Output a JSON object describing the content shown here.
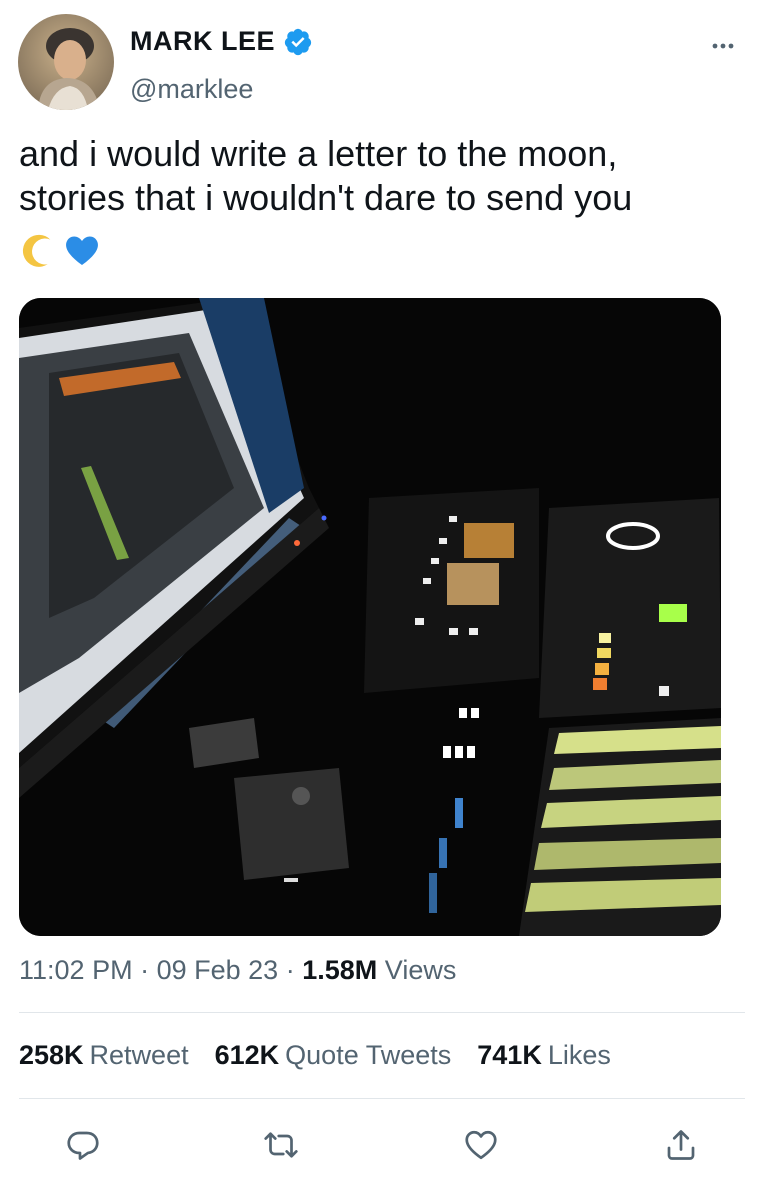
{
  "author": {
    "display_name": "MARK LEE",
    "handle": "@marklee",
    "verified": true,
    "avatar_icon": "avatar-photo"
  },
  "tweet": {
    "text_line1": "and i would write a letter to the moon,",
    "text_line2": "stories that i wouldn't dare to send you",
    "emojis": [
      "crescent-moon-icon",
      "blue-heart-icon"
    ],
    "media_description_icon": "photo-music-studio"
  },
  "meta": {
    "time": "11:02 PM",
    "separator": "·",
    "date": "09 Feb 23",
    "views_count": "1.58M",
    "views_label": "Views"
  },
  "stats": {
    "retweets_count": "258K",
    "retweets_label": "Retweet",
    "quotes_count": "612K",
    "quotes_label": "Quote Tweets",
    "likes_count": "741K",
    "likes_label": "Likes"
  },
  "colors": {
    "text_primary": "#0f1419",
    "text_secondary": "#536471",
    "verified_blue": "#1d9bf0",
    "divider": "#e1e6ea"
  }
}
